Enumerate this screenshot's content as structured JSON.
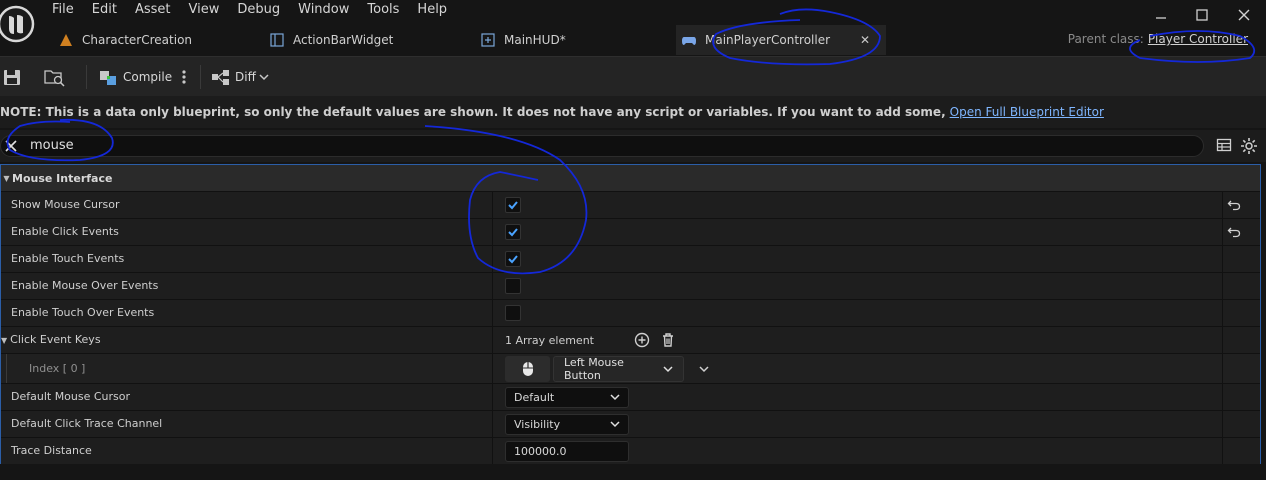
{
  "menu": [
    "File",
    "Edit",
    "Asset",
    "View",
    "Debug",
    "Window",
    "Tools",
    "Help"
  ],
  "tabs": [
    {
      "label": "CharacterCreation",
      "icon": "character-icon"
    },
    {
      "label": "ActionBarWidget",
      "icon": "widget-icon"
    },
    {
      "label": "MainHUD*",
      "icon": "hud-icon"
    },
    {
      "label": "MainPlayerController",
      "icon": "gamepad-icon"
    }
  ],
  "parent_class": {
    "label": "Parent class:",
    "value": "Player Controller"
  },
  "toolbar": {
    "compile": "Compile",
    "diff": "Diff"
  },
  "note": {
    "text": "NOTE: This is a data only blueprint, so only the default values are shown.  It does not have any script or variables.  If you want to add some,",
    "link": "Open Full Blueprint Editor"
  },
  "search": {
    "value": "mouse"
  },
  "details": {
    "category": "Mouse Interface",
    "rows": [
      {
        "name": "Show Mouse Cursor",
        "checked": true
      },
      {
        "name": "Enable Click Events",
        "checked": true
      },
      {
        "name": "Enable Touch Events",
        "checked": true
      },
      {
        "name": "Enable Mouse Over Events",
        "checked": false
      },
      {
        "name": "Enable Touch Over Events",
        "checked": false
      }
    ],
    "click_event_keys": {
      "name": "Click Event Keys",
      "value": "1 Array element"
    },
    "index_row": {
      "name": "Index [ 0 ]",
      "value": "Left Mouse Button"
    },
    "default_mouse_cursor": {
      "name": "Default Mouse Cursor",
      "value": "Default"
    },
    "default_click_trace": {
      "name": "Default Click Trace Channel",
      "value": "Visibility"
    },
    "trace_distance": {
      "name": "Trace Distance",
      "value": "100000.0"
    }
  },
  "colors": {
    "accent": "#2b5ea8",
    "checkbox": "#4aa3ff",
    "annotation": "#1428d8",
    "link": "#7fb6ff"
  }
}
